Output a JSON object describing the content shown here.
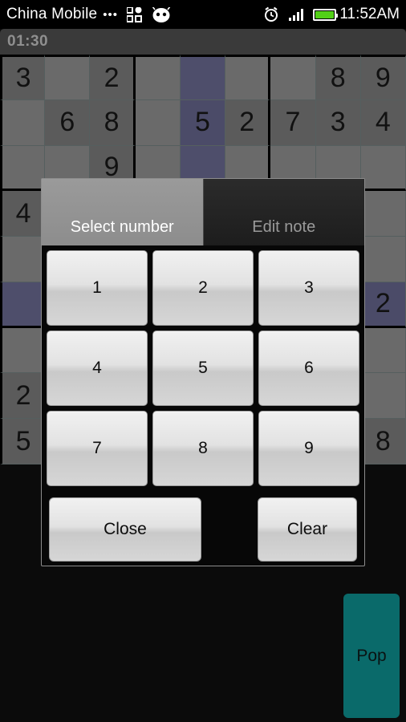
{
  "status_bar": {
    "carrier": "China Mobile",
    "dots": "•••",
    "apps_icon": "apps-grid-icon",
    "android_icon": "android-robot-icon",
    "alarm_icon": "alarm-clock-icon",
    "signal_icon": "signal-bars-icon",
    "battery_icon": "battery-icon",
    "clock": "11:52AM"
  },
  "timer": {
    "elapsed": "01:30"
  },
  "board": {
    "rows": [
      [
        "3",
        "",
        "2",
        "",
        "",
        "",
        "",
        "8",
        "9"
      ],
      [
        "",
        "6",
        "8",
        "",
        "5",
        "2",
        "7",
        "3",
        "4"
      ],
      [
        "",
        "",
        "9",
        "",
        "",
        "",
        "",
        "",
        ""
      ],
      [
        "4",
        "",
        "",
        "",
        "",
        "",
        "",
        "",
        ""
      ],
      [
        "",
        "",
        "",
        "",
        "",
        "",
        "",
        "",
        ""
      ],
      [
        "",
        "",
        "",
        "",
        "",
        "",
        "",
        "",
        "2"
      ],
      [
        "",
        "",
        "",
        "",
        "",
        "",
        "",
        "",
        ""
      ],
      [
        "2",
        "",
        "",
        "",
        "",
        "",
        "",
        "",
        ""
      ],
      [
        "5",
        "",
        "",
        "",
        "",
        "",
        "",
        "",
        "8"
      ]
    ],
    "highlight_column": 4,
    "highlight_row": 5,
    "colors": {
      "empty_cell": "#6a6a6a",
      "filled_cell": "#5b5b5b",
      "highlight_cell": "#4e4e6b",
      "grid_line": "#000000",
      "digit": "#111111"
    }
  },
  "dialog": {
    "tabs": [
      {
        "label": "Select number",
        "active": true
      },
      {
        "label": "Edit note",
        "active": false
      }
    ],
    "numbers": [
      "1",
      "2",
      "3",
      "4",
      "5",
      "6",
      "7",
      "8",
      "9"
    ],
    "close_label": "Close",
    "clear_label": "Clear"
  },
  "pop_button": {
    "label": "Pop",
    "color": "#0a6a6a"
  }
}
